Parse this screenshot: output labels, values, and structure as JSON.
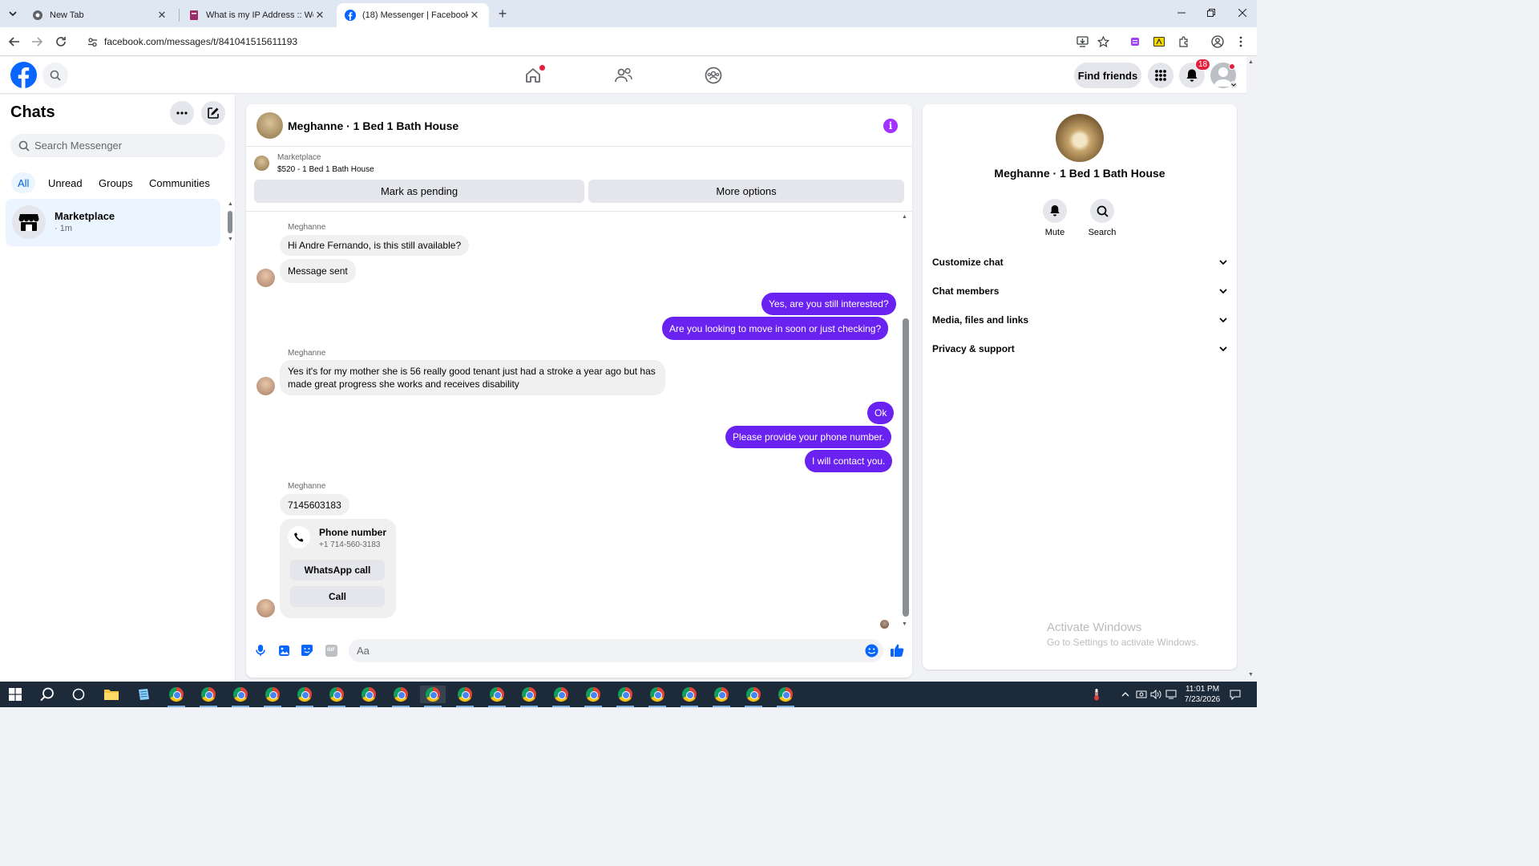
{
  "browser": {
    "tabs": [
      {
        "title": "New Tab",
        "active": false
      },
      {
        "title": "What is my IP Address :: WebBr",
        "active": false
      },
      {
        "title": "(18) Messenger | Facebook",
        "active": true
      }
    ],
    "url": "facebook.com/messages/t/841041515611193"
  },
  "fb_nav": {
    "find_friends": "Find friends",
    "notification_count": "18"
  },
  "chats": {
    "title": "Chats",
    "search_placeholder": "Search Messenger",
    "filters": [
      "All",
      "Unread",
      "Groups",
      "Communities"
    ],
    "active_filter": "All",
    "items": [
      {
        "name": "Marketplace",
        "time": "· 1m"
      }
    ]
  },
  "conversation": {
    "title": "Meghanne · 1 Bed 1 Bath House",
    "marketplace_label": "Marketplace",
    "listing": "$520 - 1 Bed 1 Bath House",
    "mark_pending": "Mark as pending",
    "more_options": "More options",
    "messages": {
      "sender1": "Meghanne",
      "in1": "Hi Andre Fernando, is this still available?",
      "in2": "Message sent",
      "out1": "Yes, are you still interested?",
      "out2": "Are you looking to move in soon or just checking?",
      "sender2": "Meghanne",
      "in3": "Yes it's for my mother she is 56 really good tenant just had a stroke a year ago but has made great progress she works and receives disability",
      "out3": "Ok",
      "out4": "Please provide your phone number.",
      "out5": "I will contact you.",
      "sender3": "Meghanne",
      "in4": "7145603183"
    },
    "phone_card": {
      "title": "Phone number",
      "number": "+1 714-560-3183",
      "whatsapp": "WhatsApp call",
      "call": "Call"
    },
    "composer_placeholder": "Aa"
  },
  "info_panel": {
    "name": "Meghanne · 1 Bed 1 Bath House",
    "actions": [
      "Mute",
      "Search"
    ],
    "sections": [
      "Customize chat",
      "Chat members",
      "Media, files and links",
      "Privacy & support"
    ]
  },
  "watermark": {
    "line1": "Activate Windows",
    "line2": "Go to Settings to activate Windows."
  },
  "taskbar": {
    "time": "11:01 PM",
    "date": "7/23/2026"
  },
  "colors": {
    "fb_blue": "#0866ff",
    "outgoing_bubble": "#6a22f0",
    "info_purple": "#a033ff",
    "notif_red": "#e41e3f"
  }
}
